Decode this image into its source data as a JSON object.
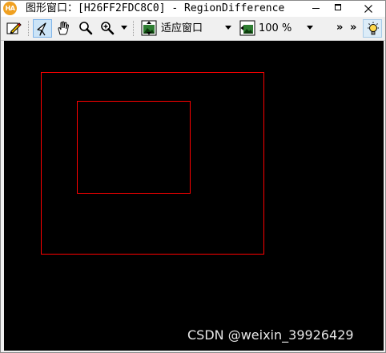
{
  "window": {
    "title": "图形窗口：[H26FF2FDC8C0] - RegionDifference",
    "app_icon_text": "HA"
  },
  "toolbar": {
    "buttons": [
      {
        "icon": "pencil-icon"
      },
      {
        "icon": "pointer-arrow-icon",
        "active": true
      },
      {
        "icon": "hand-pan-icon"
      },
      {
        "icon": "magnifier-icon"
      },
      {
        "icon": "zoom-plus-icon"
      }
    ],
    "fit_mode": {
      "icon": "fit-window-icon",
      "label": "适应窗口"
    },
    "zoom": {
      "icon": "zoom-percent-icon",
      "label": "100 %"
    },
    "overflow_left": "»",
    "overflow_right": "»",
    "light_icon": "lightbulb-icon"
  },
  "canvas": {
    "background": "#000000",
    "region_color": "#ff0000"
  },
  "watermark": {
    "text": "CSDN @weixin_39926429"
  }
}
